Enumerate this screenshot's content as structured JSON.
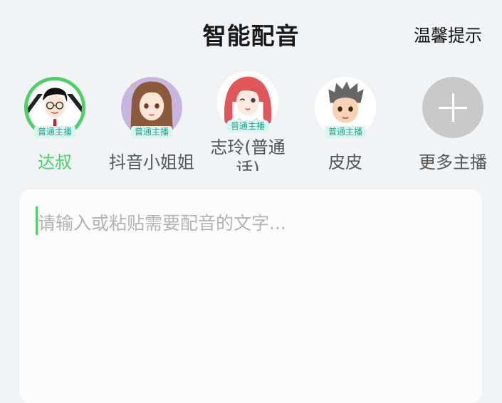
{
  "header": {
    "title": "智能配音",
    "tips_label": "温馨提示"
  },
  "voices": [
    {
      "name": "达叔",
      "badge": "普通主播",
      "selected": true
    },
    {
      "name": "抖音小姐姐",
      "badge": "普通主播",
      "selected": false
    },
    {
      "name": "志玲(普通话)",
      "badge": "普通主播",
      "selected": false
    },
    {
      "name": "皮皮",
      "badge": "普通主播",
      "selected": false
    }
  ],
  "more": {
    "label": "更多主播"
  },
  "editor": {
    "placeholder": "请输入或粘贴需要配音的文字..."
  },
  "colors": {
    "accent": "#4cd06a",
    "badge_bg": "#d7f7f1",
    "badge_text": "#1fa88d"
  }
}
